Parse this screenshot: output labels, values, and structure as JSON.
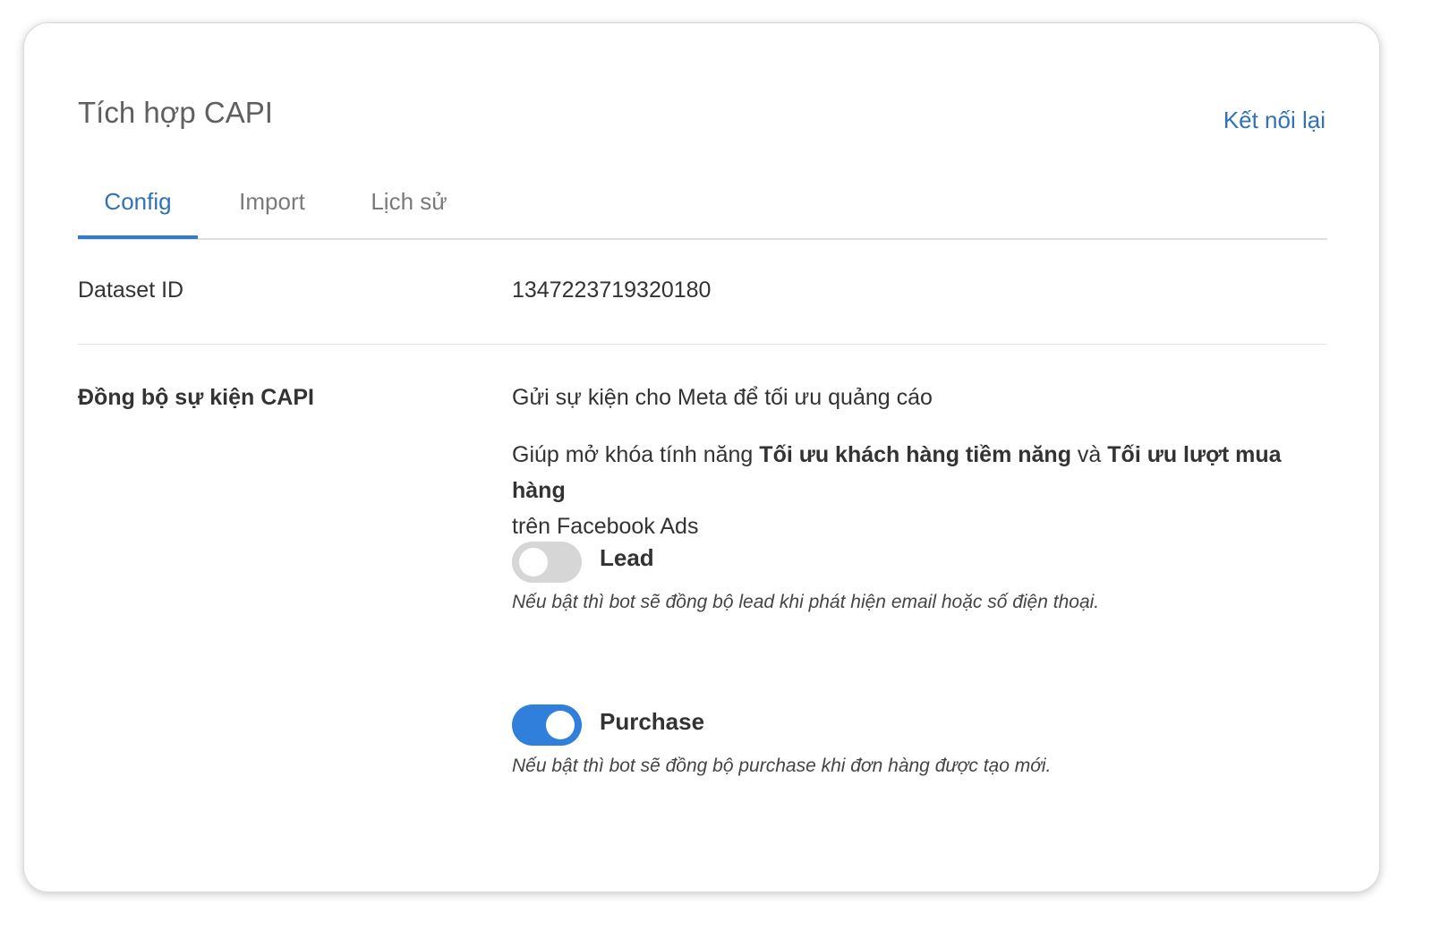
{
  "header": {
    "title": "Tích hợp CAPI",
    "reconnect_label": "Kết nối lại"
  },
  "tabs": [
    {
      "label": "Config",
      "active": true
    },
    {
      "label": "Import",
      "active": false
    },
    {
      "label": "Lịch sử",
      "active": false
    }
  ],
  "dataset": {
    "label": "Dataset ID",
    "value": "1347223719320180"
  },
  "sync": {
    "label": "Đồng bộ sự kiện CAPI",
    "description": "Gửi sự kiện cho Meta để tối ưu quảng cáo",
    "unlock_prefix": "Giúp mở khóa tính năng ",
    "unlock_feature_1": "Tối ưu khách hàng tiềm năng",
    "unlock_and": " và ",
    "unlock_feature_2": "Tối ưu lượt mua hàng",
    "unlock_suffix": "trên Facebook Ads",
    "events": [
      {
        "name": "Lead",
        "enabled": false,
        "hint": "Nếu bật thì bot sẽ đồng bộ lead khi phát hiện email hoặc số điện thoại."
      },
      {
        "name": "Purchase",
        "enabled": true,
        "hint": "Nếu bật thì bot sẽ đồng bộ purchase khi đơn hàng được tạo mới."
      }
    ]
  },
  "colors": {
    "accent": "#2f72b8",
    "toggle_on": "#2f7fdb",
    "toggle_off": "#d6d6d6"
  }
}
